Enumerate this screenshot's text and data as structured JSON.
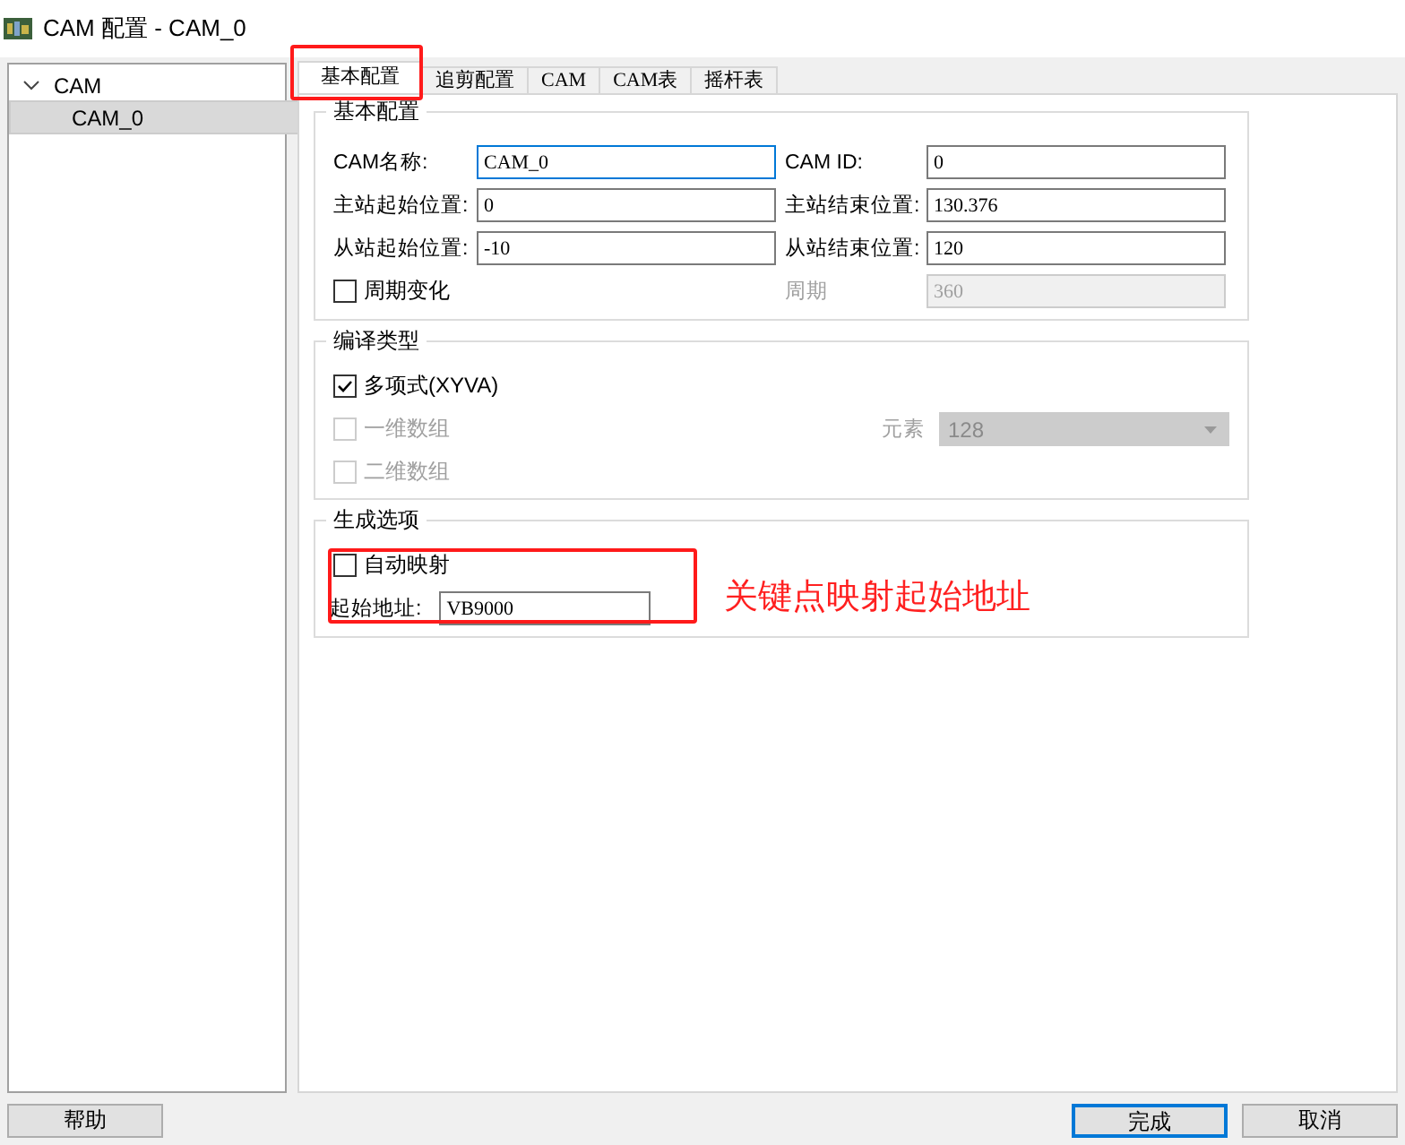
{
  "window": {
    "title": "CAM 配置 - CAM_0"
  },
  "tree": [
    {
      "label": "CAM",
      "expanded": true,
      "selected": false,
      "children": [
        {
          "label": "CAM_0",
          "selected": true
        }
      ]
    }
  ],
  "tabs": [
    {
      "label": "基本配置",
      "selected": true
    },
    {
      "label": "追剪配置",
      "selected": false
    },
    {
      "label": "CAM",
      "selected": false
    },
    {
      "label": "CAM表",
      "selected": false
    },
    {
      "label": "摇杆表",
      "selected": false
    }
  ],
  "basic_group": {
    "title": "基本配置",
    "items": [
      {
        "kind": "field",
        "label": "CAM名称:",
        "value": "CAM_0",
        "focused": true,
        "disabled": false
      },
      {
        "kind": "field",
        "label": "CAM ID:",
        "value": "0",
        "focused": false,
        "disabled": false
      },
      {
        "kind": "field",
        "label": "主站起始位置:",
        "value": "0",
        "focused": false,
        "disabled": false
      },
      {
        "kind": "field",
        "label": "主站结束位置:",
        "value": "130.376",
        "focused": false,
        "disabled": false
      },
      {
        "kind": "field",
        "label": "从站起始位置:",
        "value": "-10",
        "focused": false,
        "disabled": false
      },
      {
        "kind": "field",
        "label": "从站结束位置:",
        "value": "120",
        "focused": false,
        "disabled": false
      },
      {
        "kind": "checkbox",
        "label": "周期变化",
        "checked": false,
        "disabled": false
      },
      {
        "kind": "field",
        "label": "周期",
        "value": "360",
        "focused": false,
        "disabled": true
      }
    ]
  },
  "compile_group": {
    "title": "编译类型",
    "options": [
      {
        "label": "多项式(XYVA)",
        "checked": true,
        "disabled": false
      },
      {
        "label": "一维数组",
        "checked": false,
        "disabled": true
      },
      {
        "label": "二维数组",
        "checked": false,
        "disabled": true
      }
    ],
    "element_select": {
      "label": "元素",
      "value": "128",
      "disabled": true
    }
  },
  "output_group": {
    "title": "生成选项",
    "auto_map": {
      "label": "自动映射",
      "checked": false
    },
    "start_address": {
      "label": "起始地址:",
      "value": "VB9000"
    }
  },
  "annotation": {
    "text": "关键点映射起始地址"
  },
  "buttons": [
    {
      "label": "帮助",
      "default": false
    },
    {
      "label": "完成",
      "default": true
    },
    {
      "label": "取消",
      "default": false
    }
  ]
}
